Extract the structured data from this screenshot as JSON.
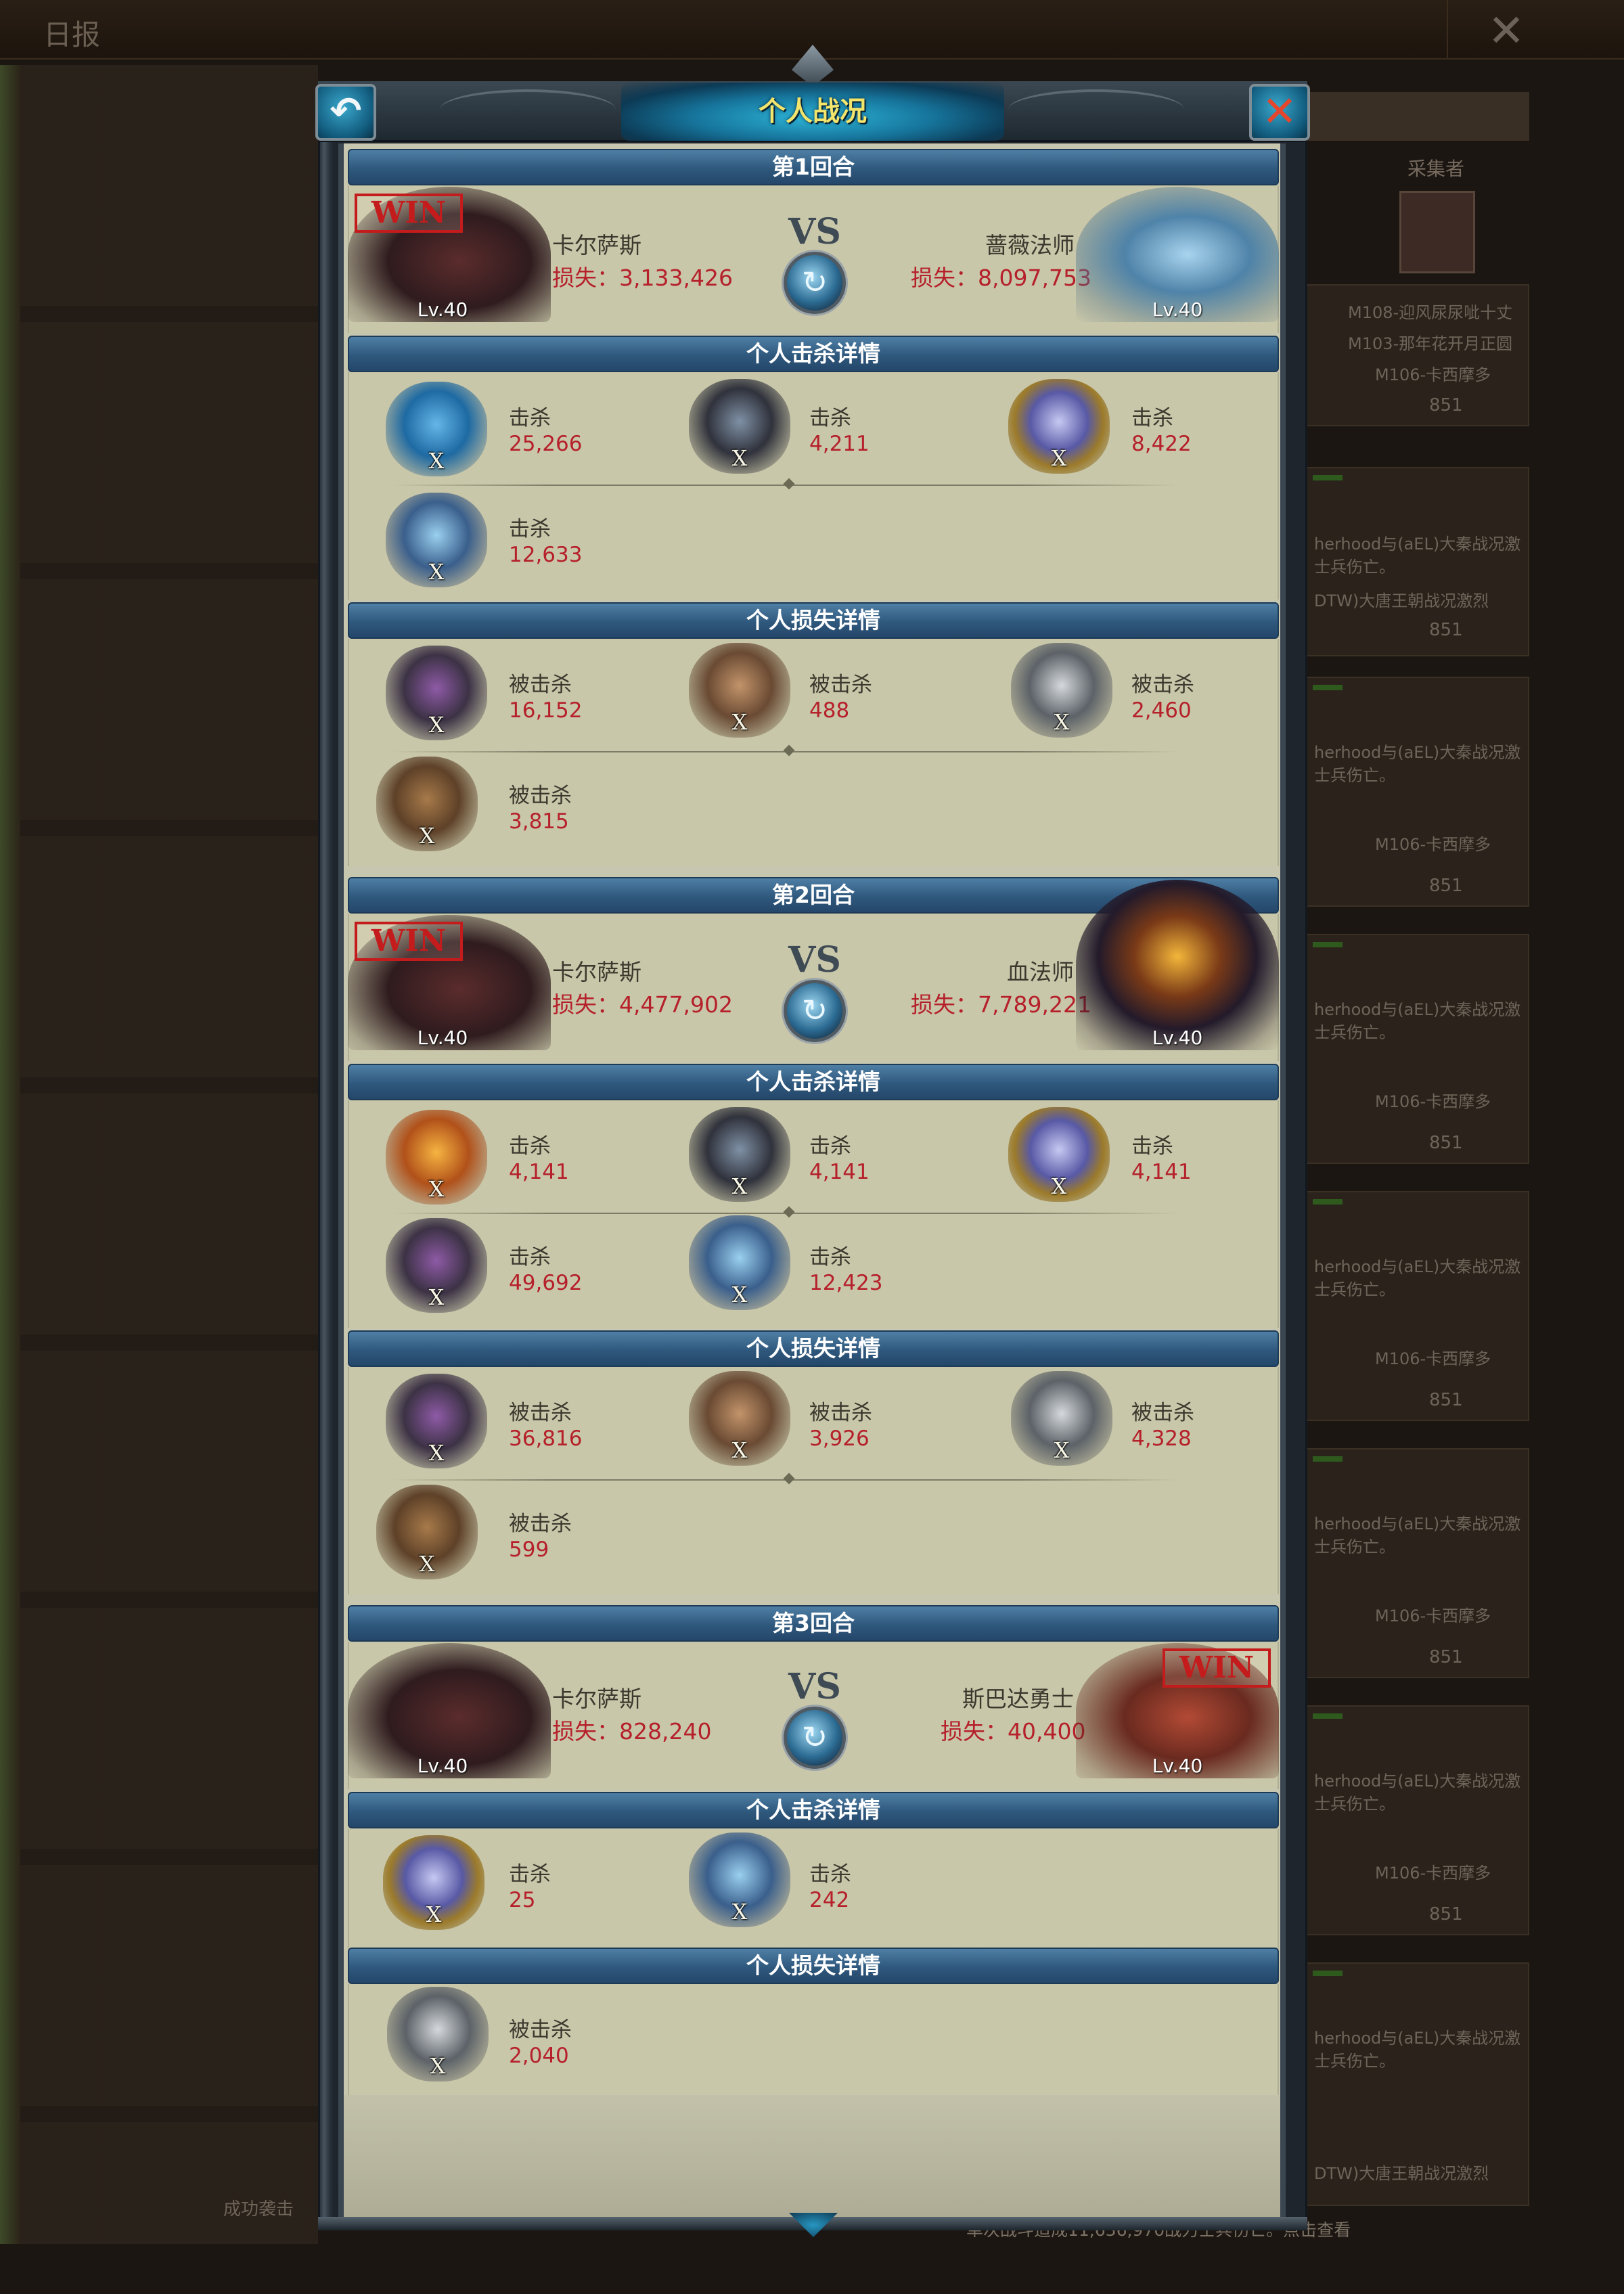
{
  "background": {
    "title": "日报",
    "close_glyph": "✕",
    "column_label": "采集者",
    "side_text": "成功袭击",
    "entries": [
      {
        "line1": "M108-迎风尿尿呲十丈",
        "line2": "M103-那年花开月正圆",
        "line3": "M106-卡西摩多",
        "num": "851"
      },
      {
        "line1": "herhood与(aEL)大秦战况激",
        "line2": "士兵伤亡。",
        "line3": "DTW)大唐王朝战况激烈",
        "num": "851"
      },
      {
        "line1": "herhood与(aEL)大秦战况激",
        "line2": "士兵伤亡。",
        "line3": "M106-卡西摩多",
        "num": "851"
      },
      {
        "line1": "herhood与(aEL)大秦战况激",
        "line2": "士兵伤亡。",
        "line3": "M106-卡西摩多",
        "num": "851"
      },
      {
        "line1": "herhood与(aEL)大秦战况激",
        "line2": "士兵伤亡。",
        "line3": "M106-卡西摩多",
        "num": "851"
      },
      {
        "line1": "herhood与(aEL)大秦战况激",
        "line2": "士兵伤亡。",
        "line3": "M106-卡西摩多",
        "num": "851"
      },
      {
        "line1": "herhood与(aEL)大秦战况激",
        "line2": "士兵伤亡。",
        "line3": "M106-卡西摩多",
        "num": "851"
      },
      {
        "line1": "herhood与(aEL)大秦战况激",
        "line2": "士兵伤亡。",
        "line3": "DTW)大唐王朝战况激烈",
        "num": ""
      }
    ],
    "bottom_line": "单次战斗造成11,636,970战力士兵伤亡。点击查看"
  },
  "dialog": {
    "title": "个人战况",
    "back_glyph": "↶",
    "close_glyph": "✕",
    "vs_label": "VS",
    "vs_orb_glyph": "↻",
    "win_label": "WIN",
    "level_prefix": "Lv.",
    "loss_prefix": "损失：",
    "kill_section_title": "个人击杀详情",
    "loss_section_title": "个人损失详情",
    "kill_label": "击杀",
    "killed_label": "被击杀",
    "unit_x": "X",
    "rounds": [
      {
        "title": "第1回合",
        "left": {
          "name": "卡尔萨斯",
          "loss": "损失：3,133,426",
          "level": "Lv.40",
          "win": true,
          "portrait": "death-knight"
        },
        "right": {
          "name": "蔷薇法师",
          "loss": "损失：8,097,753",
          "level": "Lv.40",
          "win": false,
          "portrait": "ice-mage"
        },
        "kills": [
          {
            "unit": "phoenix",
            "value": "25,266"
          },
          {
            "unit": "dark-knight",
            "value": "4,211"
          },
          {
            "unit": "genie",
            "value": "8,422"
          },
          {
            "unit": "storm-mage",
            "value": "12,633"
          }
        ],
        "losses": [
          {
            "unit": "scorpion",
            "value": "16,152"
          },
          {
            "unit": "dwarf",
            "value": "488"
          },
          {
            "unit": "griffin",
            "value": "2,460"
          },
          {
            "unit": "ogre",
            "value": "3,815"
          }
        ]
      },
      {
        "title": "第2回合",
        "left": {
          "name": "卡尔萨斯",
          "loss": "损失：4,477,902",
          "level": "Lv.40",
          "win": true,
          "portrait": "death-knight"
        },
        "right": {
          "name": "血法师",
          "loss": "损失：7,789,221",
          "level": "Lv.40",
          "win": false,
          "portrait": "blood-mage"
        },
        "kills": [
          {
            "unit": "firebird",
            "value": "4,141"
          },
          {
            "unit": "dark-knight",
            "value": "4,141"
          },
          {
            "unit": "genie",
            "value": "4,141"
          },
          {
            "unit": "scorpion",
            "value": "49,692"
          },
          {
            "unit": "storm-mage",
            "value": "12,423"
          }
        ],
        "losses": [
          {
            "unit": "scorpion",
            "value": "36,816"
          },
          {
            "unit": "dwarf",
            "value": "3,926"
          },
          {
            "unit": "griffin",
            "value": "4,328"
          },
          {
            "unit": "ogre",
            "value": "599"
          }
        ]
      },
      {
        "title": "第3回合",
        "left": {
          "name": "卡尔萨斯",
          "loss": "损失：828,240",
          "level": "Lv.40",
          "win": false,
          "portrait": "death-knight"
        },
        "right": {
          "name": "斯巴达勇士",
          "loss": "损失：40,400",
          "level": "Lv.40",
          "win": true,
          "portrait": "spartan"
        },
        "kills": [
          {
            "unit": "genie",
            "value": "25"
          },
          {
            "unit": "storm-mage",
            "value": "242"
          }
        ],
        "losses": [
          {
            "unit": "griffin",
            "value": "2,040"
          }
        ]
      }
    ]
  },
  "colors": {
    "bar_blue": "#2f587d",
    "panel": "#c9c7a9",
    "loss_red": "#b5202b",
    "title_yellow": "#f3e46b",
    "win_red": "#c41c1c"
  }
}
